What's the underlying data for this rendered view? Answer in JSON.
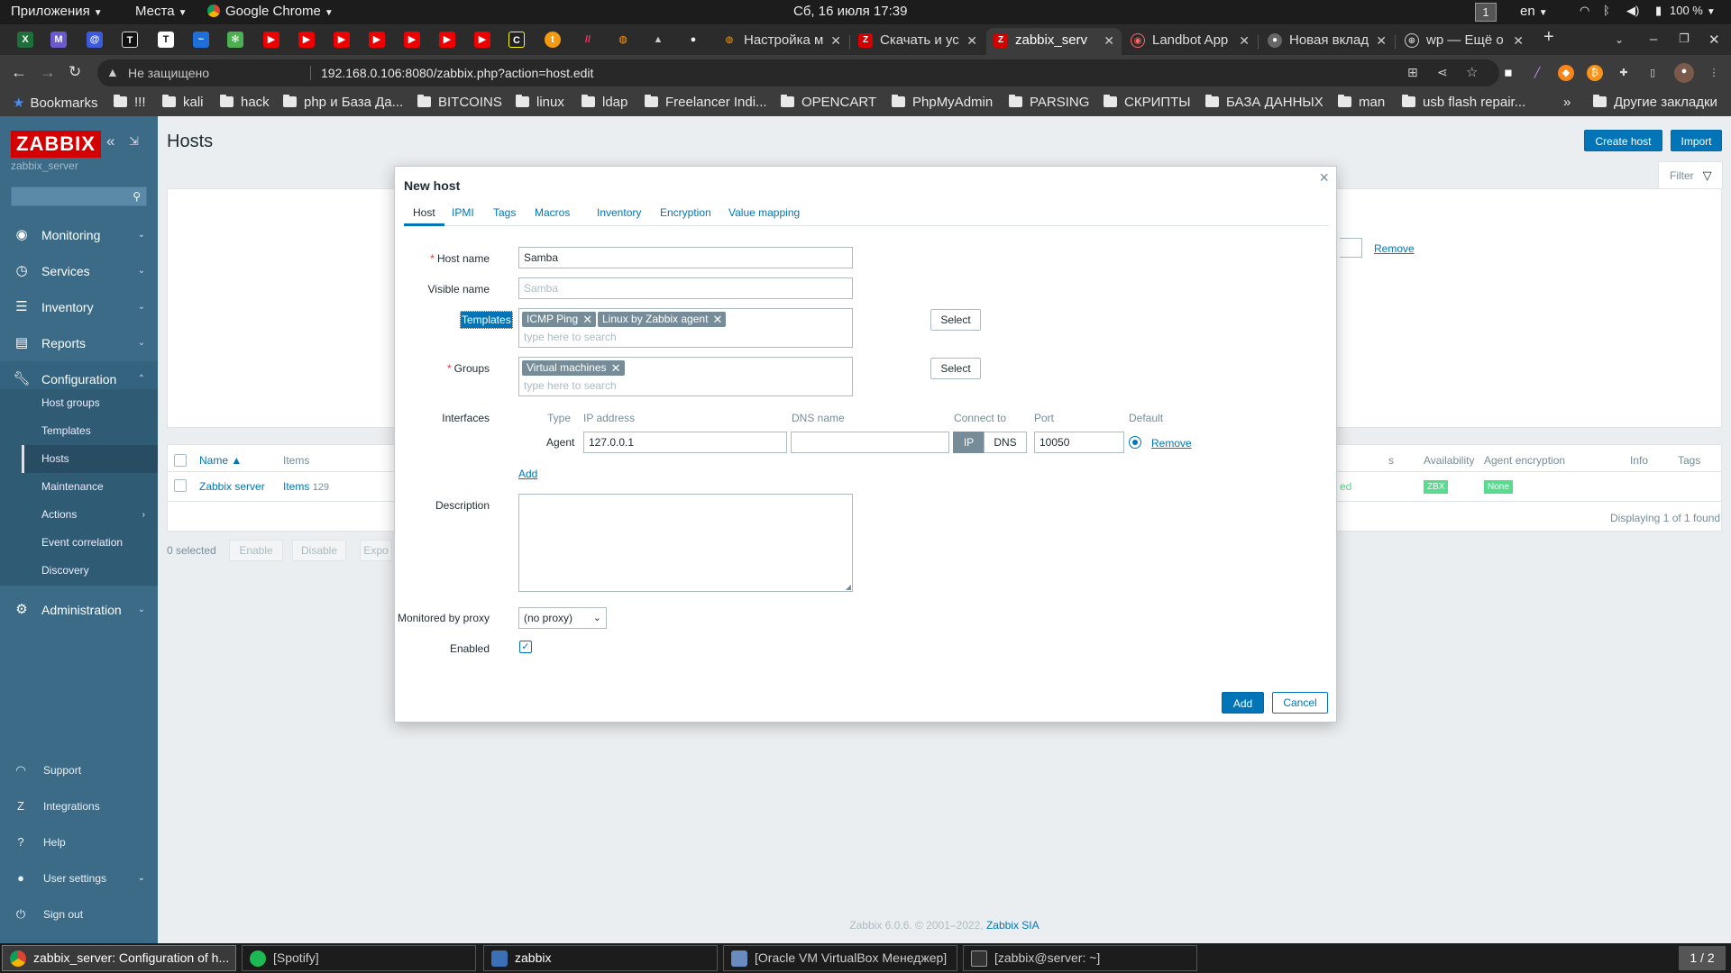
{
  "system": {
    "apps_menu": "Приложения",
    "places_menu": "Места",
    "active_app": "Google Chrome",
    "clock": "Сб, 16 июля  17:39",
    "workspace": "1",
    "lang": "en",
    "battery": "100 %"
  },
  "browser": {
    "tabs": [
      {
        "label": "Настройка м",
        "icon": "gear-icon"
      },
      {
        "label": "Скачать и ус",
        "icon": "zabbix-icon"
      },
      {
        "label": "zabbix_serv",
        "icon": "zabbix-icon",
        "active": true
      },
      {
        "label": "Landbot App",
        "icon": "bot-icon"
      },
      {
        "label": "Новая вклад",
        "icon": "chrome-icon"
      },
      {
        "label": "wp — Ещё о",
        "icon": "globe-icon"
      }
    ],
    "nonsecure_label": "Не защищено",
    "url": "192.168.0.106:8080/zabbix.php?action=host.edit",
    "bookmarks": [
      "Bookmarks",
      "!!!",
      "kali",
      "hack",
      "php и База Да...",
      "BITCOINS",
      "linux",
      "ldap",
      "Freelancer Indi...",
      "OPENCART",
      "PhpMyAdmin",
      "PARSING",
      "СКРИПТЫ",
      "БАЗА ДАННЫХ",
      "man",
      "usb flash repair..."
    ],
    "overflow": "»",
    "other_bookmarks": "Другие закладки"
  },
  "sidebar": {
    "logo": "ZABBIX",
    "server": "zabbix_server",
    "menu": [
      {
        "label": "Monitoring",
        "icon": "eye-icon"
      },
      {
        "label": "Services",
        "icon": "clock-icon"
      },
      {
        "label": "Inventory",
        "icon": "list-icon"
      },
      {
        "label": "Reports",
        "icon": "chart-icon"
      },
      {
        "label": "Configuration",
        "icon": "wrench-icon"
      }
    ],
    "config_items": [
      "Host groups",
      "Templates",
      "Hosts",
      "Maintenance",
      "Actions",
      "Event correlation",
      "Discovery"
    ],
    "admin": "Administration",
    "bottom": [
      "Support",
      "Integrations",
      "Help",
      "User settings",
      "Sign out"
    ]
  },
  "page": {
    "title": "Hosts",
    "create_host": "Create host",
    "import": "Import",
    "filter": "Filter",
    "filter_remove": "Remove",
    "table": {
      "headers": [
        "Name ▲",
        "Items",
        "Availability",
        "Agent encryption",
        "Info",
        "Tags"
      ],
      "row": {
        "name": "Zabbix server",
        "items_link": "Items",
        "items_count": "129",
        "status_partial": "ed",
        "availability": "ZBX",
        "encryption": "None"
      },
      "displaying": "Displaying 1 of 1 found"
    },
    "selected": "0 selected",
    "mass_buttons": [
      "Enable",
      "Disable",
      "Expo"
    ],
    "footer_text": "Zabbix 6.0.6. © 2001–2022, ",
    "footer_link": "Zabbix SIA"
  },
  "modal": {
    "title": "New host",
    "tabs": [
      "Host",
      "IPMI",
      "Tags",
      "Macros",
      "Inventory",
      "Encryption",
      "Value mapping"
    ],
    "host_name_label": "Host name",
    "host_name": "Samba",
    "visible_name_label": "Visible name",
    "visible_name_placeholder": "Samba",
    "templates_label": "Templates",
    "templates": [
      "ICMP Ping",
      "Linux by Zabbix agent"
    ],
    "search_placeholder": "type here to search",
    "select": "Select",
    "groups_label": "Groups",
    "groups": [
      "Virtual machines"
    ],
    "interfaces_label": "Interfaces",
    "iface_headers": [
      "Type",
      "IP address",
      "DNS name",
      "Connect to",
      "Port",
      "Default"
    ],
    "iface": {
      "type": "Agent",
      "ip": "127.0.0.1",
      "dns": "",
      "connect_ip": "IP",
      "connect_dns": "DNS",
      "port": "10050",
      "remove": "Remove"
    },
    "add_link": "Add",
    "description_label": "Description",
    "proxy_label": "Monitored by proxy",
    "proxy_value": "(no proxy)",
    "enabled_label": "Enabled",
    "add_button": "Add",
    "cancel_button": "Cancel"
  },
  "taskbar": {
    "tasks": [
      "zabbix_server: Configuration of h...",
      "[Spotify]",
      "zabbix",
      "[Oracle VM VirtualBox Менеджер]",
      "[zabbix@server: ~]"
    ],
    "pager": "1 / 2"
  }
}
